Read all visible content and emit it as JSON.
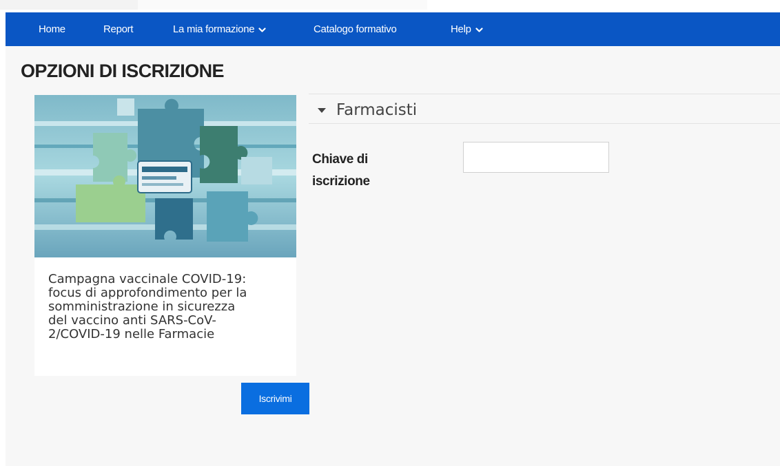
{
  "navbar": {
    "items": [
      {
        "label": "Home",
        "has_dropdown": false
      },
      {
        "label": "Report",
        "has_dropdown": false
      },
      {
        "label": "La mia formazione",
        "has_dropdown": true
      },
      {
        "label": "Catalogo formativo",
        "has_dropdown": false
      },
      {
        "label": "Help",
        "has_dropdown": true
      }
    ],
    "background_color": "#0a56c4"
  },
  "page": {
    "title": "OPZIONI DI ISCRIZIONE"
  },
  "course": {
    "image_icon": "puzzle-vaccine-image",
    "name": "Campagna vaccinale COVID-19:\nfocus di approfondimento per la\nsomministrazione in sicurezza\ndel vaccino anti SARS-CoV-\n2/COVID-19 nelle Farmacie",
    "enrol_button_label": "Iscrivimi"
  },
  "enrol_section": {
    "title": "Farmacisti",
    "expanded": true,
    "field_label": "Chiave di\niscrizione",
    "field_value": "",
    "field_placeholder": ""
  },
  "colors": {
    "nav": "#0a56c4",
    "button": "#0a6ee0",
    "page_background": "#f7f7f7"
  }
}
